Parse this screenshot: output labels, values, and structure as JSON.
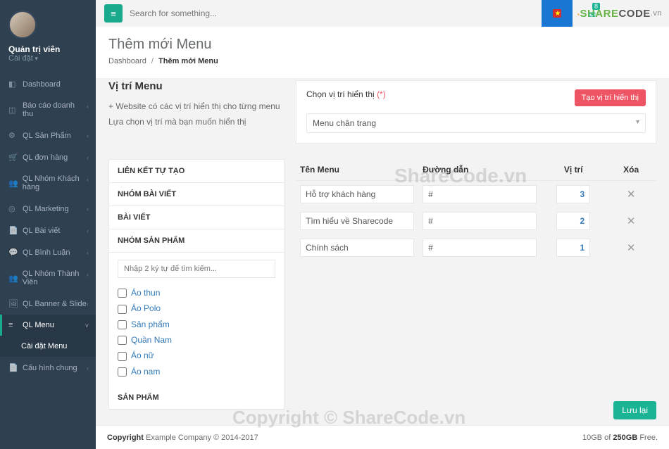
{
  "profile": {
    "name": "Quản trị viên",
    "subtitle": "Cài đặt"
  },
  "search_placeholder": "Search for something...",
  "topbar": {
    "badge": "8"
  },
  "logo": {
    "part1": "SHARE",
    "part2": "CODE",
    "part3": ".vn"
  },
  "sidebar": [
    {
      "icon": "◧",
      "label": "Dashboard",
      "chev": false
    },
    {
      "icon": "◫",
      "label": "Báo cáo doanh thu",
      "chev": true
    },
    {
      "icon": "⚙",
      "label": "QL Sản Phẩm",
      "chev": true
    },
    {
      "icon": "🛒",
      "label": "QL đơn hàng",
      "chev": true
    },
    {
      "icon": "👥",
      "label": "QL Nhóm Khách hàng",
      "chev": true
    },
    {
      "icon": "◎",
      "label": "QL Marketing",
      "chev": true
    },
    {
      "icon": "📄",
      "label": "QL Bài viết",
      "chev": true
    },
    {
      "icon": "💬",
      "label": "QL Bình Luận",
      "chev": true
    },
    {
      "icon": "👥",
      "label": "QL Nhóm Thành Viên",
      "chev": true
    },
    {
      "icon": "🖼",
      "label": "QL Banner & Slide",
      "chev": true
    },
    {
      "icon": "≡",
      "label": "QL Menu",
      "chev": true,
      "active": true
    },
    {
      "sub": true,
      "label": "Cài đặt Menu"
    },
    {
      "icon": "📄",
      "label": "Cấu hình chung",
      "chev": true
    }
  ],
  "page": {
    "title": "Thêm mới Menu",
    "crumb_home": "Dashboard",
    "crumb_current": "Thêm mới Menu"
  },
  "position_info": {
    "heading": "Vị trí Menu",
    "line1": "+ Website có các vị trí hiển thị cho từng menu",
    "line2": "Lựa chọn vị trí mà bạn muốn hiển thị"
  },
  "position_panel": {
    "label": "Chọn vị trí hiển thị",
    "required": "(*)",
    "create_btn": "Tạo vị trí hiển thị",
    "selected": "Menu chân trang"
  },
  "accordion": {
    "items": [
      "LIÊN KẾT TỰ TẠO",
      "NHÓM BÀI VIẾT",
      "BÀI VIẾT",
      "NHÓM SẢN PHẨM"
    ],
    "search_placeholder": "Nhập 2 ký tự để tìm kiếm...",
    "categories": [
      "Áo thun",
      "Áo Polo",
      "Sản phẩm",
      "Quần Nam",
      "Áo nữ",
      "Áo nam"
    ],
    "tail": "SẢN PHẨM"
  },
  "table": {
    "headers": {
      "name": "Tên Menu",
      "link": "Đường dẫn",
      "pos": "Vị trí",
      "del": "Xóa"
    },
    "rows": [
      {
        "name": "Hỗ trợ khách hàng",
        "link": "#",
        "pos": "3"
      },
      {
        "name": "Tìm hiểu về Sharecode",
        "link": "#",
        "pos": "2"
      },
      {
        "name": "Chính sách",
        "link": "#",
        "pos": "1"
      }
    ]
  },
  "save_btn": "Lưu lại",
  "footer": {
    "left_prefix": "Copyright",
    "company": "Example Company",
    "years": "© 2014-2017",
    "right_used": "10GB",
    "right_of": " of ",
    "right_total": "250GB",
    "right_free": " Free."
  },
  "watermark": "ShareCode.vn",
  "watermark2": "Copyright © ShareCode.vn"
}
